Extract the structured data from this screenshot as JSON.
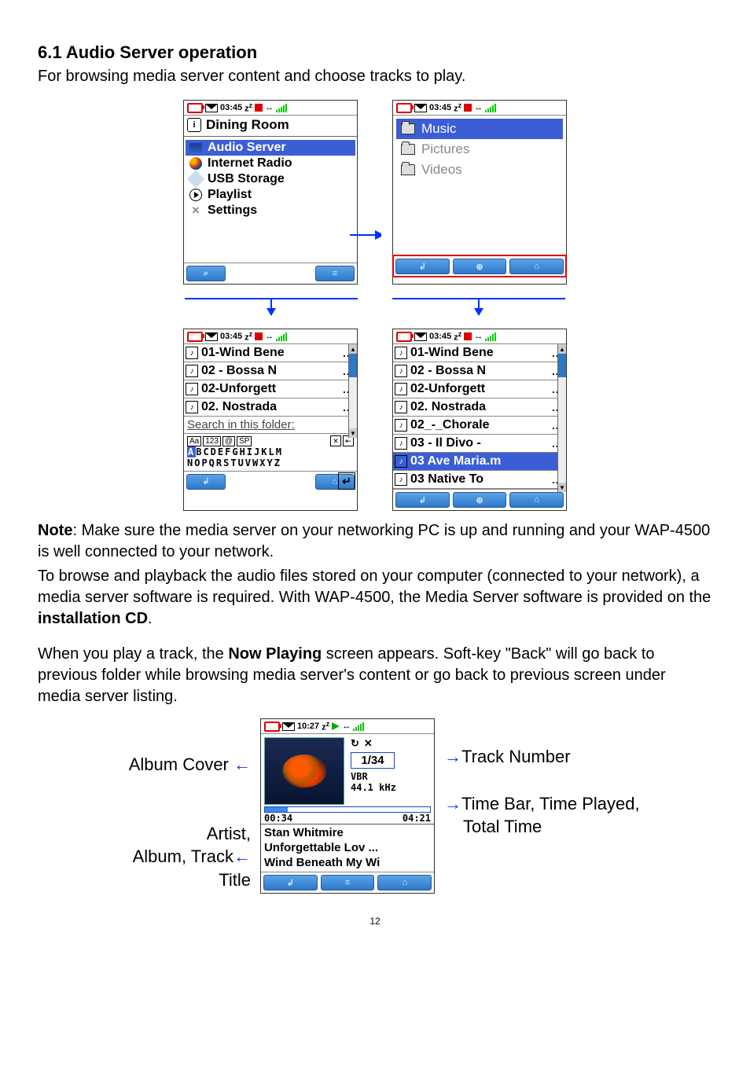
{
  "section_heading": "6.1  Audio Server operation",
  "intro_para": "For browsing media server content and choose tracks to play.",
  "status": {
    "time": "03:45",
    "z": "z",
    "zsup": "z",
    "arrows": "↔"
  },
  "home_screen": {
    "room_header": "Dining Room",
    "items": [
      "Audio Server",
      "Internet Radio",
      "USB Storage",
      "Playlist",
      "Settings"
    ],
    "selected_index": 0
  },
  "category_screen": {
    "items": [
      "Music",
      "Pictures",
      "Videos"
    ],
    "selected_index": 0
  },
  "track_list_full": {
    "items": [
      "01-Wind Bene",
      "02 - Bossa N",
      "02-Unforgett",
      "02. Nostrada",
      "02_-_Chorale",
      "03 - Il Divo -",
      "03 Ave Maria.m",
      "03 Native To"
    ],
    "selected_index": 6
  },
  "track_list_search": {
    "items": [
      "01-Wind Bene",
      "02 - Bossa N",
      "02-Unforgett",
      "02. Nostrada"
    ],
    "search_label": "Search in this folder:",
    "kbd_modes": [
      "Aa",
      "123",
      "@",
      "SP"
    ],
    "kbd_row1": "BCDEFGHIJKLM",
    "kbd_row2": "NOPQRSTUVWXYZ",
    "first_char": "A"
  },
  "softkeys": {
    "back": "↲",
    "plus": "⊕",
    "home": "⌂",
    "list": "≡",
    "search": "⌕"
  },
  "note_para_1a": "Note",
  "note_para_1b": ": Make sure the media server on your networking PC is up and running and your WAP-4500 is well connected to your network.",
  "note_para_2a": "To browse and playback the audio files stored on your computer (connected to your network), a media server software is required. With WAP-4500, the Media Server software is provided on the ",
  "note_para_2b": "installation CD",
  "note_para_2c": ".",
  "para_3a": "When you play a track, the ",
  "para_3b": "Now Playing",
  "para_3c": " screen appears. Soft-key \"Back\" will go back to previous folder while browsing media server's content or go back to previous screen under media server listing.",
  "now_playing": {
    "status_time": "10:27",
    "track_num": "1/34",
    "vbr": "VBR",
    "khz": "44.1 kHz",
    "time_played": "00:34",
    "time_total": "04:21",
    "artist": "Stan Whitmire",
    "album": "Unforgettable Lov",
    "title": "Wind Beneath My Wi"
  },
  "callouts": {
    "album_cover": "Album Cover",
    "artist_album_title_l1": "Artist,",
    "artist_album_title_l2": "Album, Track",
    "artist_album_title_l3": "Title",
    "track_number": "Track Number",
    "time_bar_l1": "Time Bar, Time Played,",
    "time_bar_l2": "Total Time"
  },
  "page_number": "12"
}
